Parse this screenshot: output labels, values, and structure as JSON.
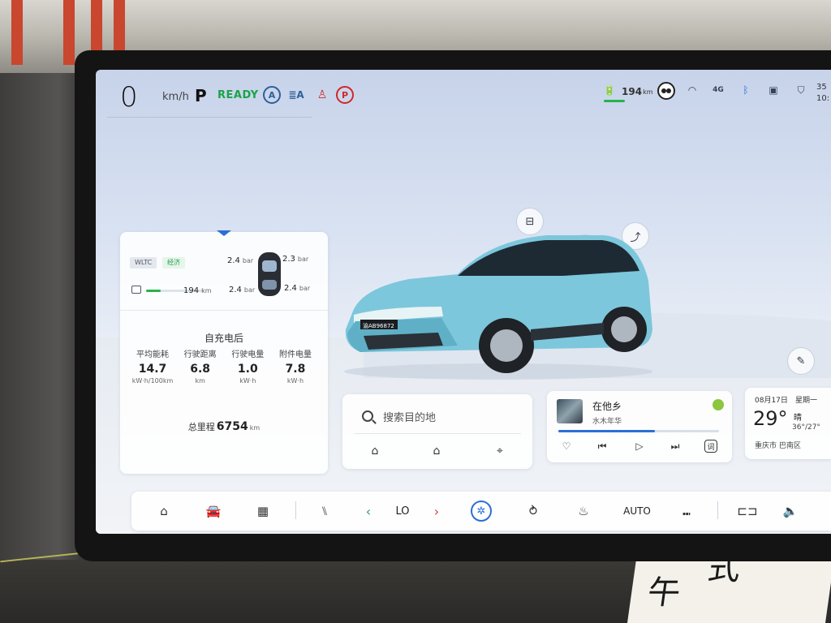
{
  "status": {
    "speed": "0",
    "speed_unit": "km/h",
    "gear": "P",
    "ready": "READY",
    "range_value": "194",
    "range_unit": "km",
    "signal": "4G",
    "right_clip_1": "35",
    "right_clip_2": "10:"
  },
  "info_card": {
    "tag_wltc": "WLTC",
    "tag_eco": "经济",
    "tire_fl": "2.4",
    "tire_fr": "2.3",
    "tire_rl": "2.4",
    "tire_rr": "2.4",
    "tire_unit": "bar",
    "range": "194",
    "range_unit": "km",
    "since_title": "自充电后",
    "stats": [
      {
        "label": "平均能耗",
        "value": "14.7",
        "unit": "kW·h/100km"
      },
      {
        "label": "行驶距离",
        "value": "6.8",
        "unit": "km"
      },
      {
        "label": "行驶电量",
        "value": "1.0",
        "unit": "kW·h"
      },
      {
        "label": "附件电量",
        "value": "7.8",
        "unit": "kW·h"
      }
    ],
    "odo_label": "总里程",
    "odo_value": "6754",
    "odo_unit": "km"
  },
  "car": {
    "plate": "渝AB96872"
  },
  "nav": {
    "search_placeholder": "搜索目的地"
  },
  "music": {
    "song": "在他乡",
    "artist": "水木年华",
    "progress": 0.6,
    "lyric_button": "词"
  },
  "weather": {
    "date": "08月17日",
    "weekday": "星期一",
    "temp": "29°",
    "condition": "晴",
    "range": "36°/27°",
    "city": "重庆市 巴南区"
  },
  "dock": {
    "temp_setting": "LO",
    "auto_label": "AUTO"
  },
  "environment": {
    "paper_text_1": "午",
    "paper_text_2": "式"
  },
  "colors": {
    "ready_green": "#1aa34a",
    "accent_blue": "#2a6fd6",
    "car_body": "#7cc7dc"
  }
}
